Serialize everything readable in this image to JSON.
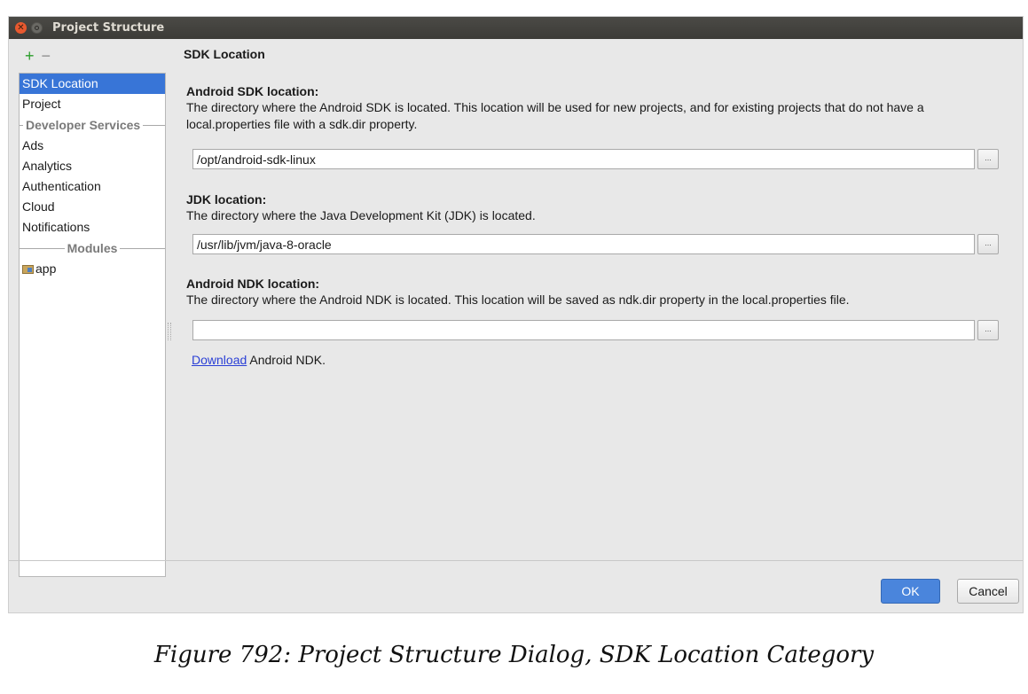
{
  "window": {
    "title": "Project Structure",
    "close_glyph": "✕"
  },
  "toolbar": {
    "add_icon": "+",
    "remove_icon": "−"
  },
  "sidebar": {
    "items": [
      {
        "label": "SDK Location",
        "selected": true
      },
      {
        "label": "Project"
      }
    ],
    "developer_services_header": "Developer Services",
    "services": [
      {
        "label": "Ads"
      },
      {
        "label": "Analytics"
      },
      {
        "label": "Authentication"
      },
      {
        "label": "Cloud"
      },
      {
        "label": "Notifications"
      }
    ],
    "modules_header": "Modules",
    "modules": [
      {
        "label": "app",
        "icon": "module-folder-icon"
      }
    ]
  },
  "content": {
    "title": "SDK Location",
    "android_sdk": {
      "heading": "Android SDK location:",
      "description": "The directory where the Android SDK is located. This location will be used for new projects, and for existing projects that do not have a local.properties file with a sdk.dir property.",
      "value": "/opt/android-sdk-linux",
      "browse_label": "..."
    },
    "jdk": {
      "heading": "JDK location:",
      "description": "The directory where the Java Development Kit (JDK) is located.",
      "value": "/usr/lib/jvm/java-8-oracle",
      "browse_label": "..."
    },
    "android_ndk": {
      "heading": "Android NDK location:",
      "description": "The directory where the Android NDK is located. This location will be saved as ndk.dir property in the local.properties file.",
      "value": "",
      "browse_label": "...",
      "download_link": "Download",
      "download_suffix": " Android NDK."
    }
  },
  "buttons": {
    "ok": "OK",
    "cancel": "Cancel"
  },
  "caption": "Figure 792: Project Structure Dialog, SDK Location Category",
  "colors": {
    "selection": "#3875d7",
    "ok_button": "#4a85dc",
    "add_icon": "#2a9d2a",
    "link": "#2a3fd6"
  }
}
